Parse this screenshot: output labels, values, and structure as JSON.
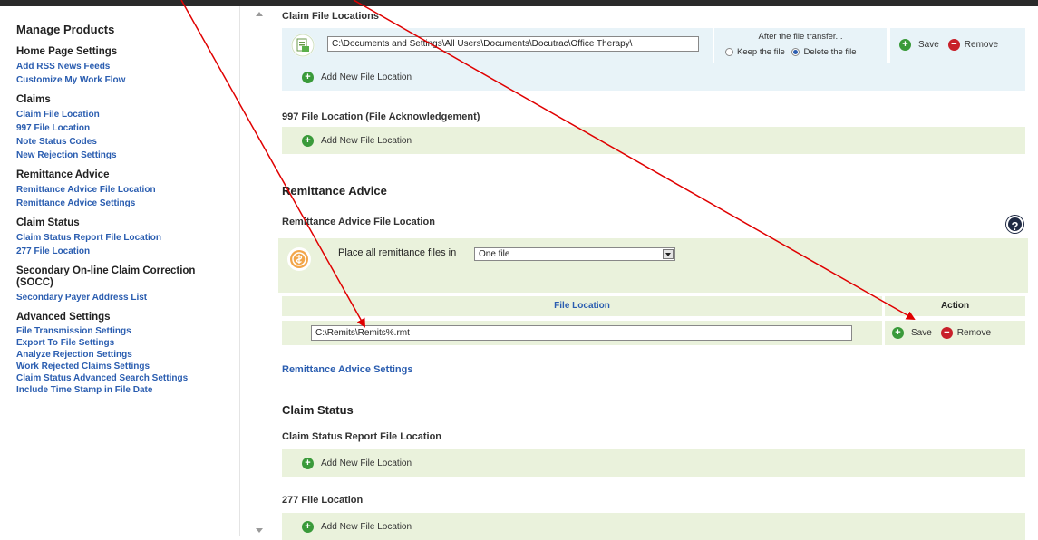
{
  "sidebar": {
    "title": "Manage Products",
    "groups": [
      {
        "heading": "Home Page Settings",
        "items": [
          "Add RSS News Feeds",
          "Customize My Work Flow"
        ]
      },
      {
        "heading": "Claims",
        "items": [
          "Claim File Location",
          "997 File Location",
          "Note Status Codes",
          "New Rejection Settings"
        ]
      },
      {
        "heading": "Remittance Advice",
        "items": [
          "Remittance Advice File Location",
          "Remittance Advice Settings"
        ]
      },
      {
        "heading": "Claim Status",
        "items": [
          "Claim Status Report File Location",
          "277 File Location"
        ]
      },
      {
        "heading": "Secondary On-line Claim Correction (SOCC)",
        "items": [
          "Secondary Payer Address List"
        ]
      },
      {
        "heading": "Advanced Settings",
        "items": [
          "File Transmission Settings",
          "Export To File Settings",
          "Analyze Rejection Settings",
          "Work Rejected Claims Settings",
          "Claim Status Advanced Search Settings",
          "Include Time Stamp in File Date"
        ]
      }
    ]
  },
  "claims": {
    "claim_file_locations_title": "Claim File Locations",
    "claim_path": "C:\\Documents and Settings\\All Users\\Documents\\Docutrac\\Office Therapy\\",
    "after_transfer_label": "After the file transfer...",
    "keep_label": "Keep the file",
    "delete_label": "Delete the file",
    "save_label": "Save",
    "remove_label": "Remove",
    "add_new_label": "Add New File Location",
    "ack_title": "997 File Location (File Acknowledgement)"
  },
  "remittance": {
    "section_title": "Remittance Advice",
    "file_location_title": "Remittance Advice File Location",
    "place_label": "Place all remittance files in",
    "place_value": "One file",
    "col_file_location": "File Location",
    "col_action": "Action",
    "path_value": "C:\\Remits\\Remits%.rmt",
    "save_label": "Save",
    "remove_label": "Remove",
    "settings_link": "Remittance Advice Settings",
    "help_symbol": "?"
  },
  "claim_status": {
    "section_title": "Claim Status",
    "report_title": "Claim Status Report File Location",
    "add_new_label": "Add New File Location",
    "loc277_title": "277 File Location"
  },
  "colors": {
    "link_blue": "#2a5db0",
    "panel_green": "#eaf2dc",
    "panel_blue": "#e8f3f8",
    "add_green": "#3a9a3a",
    "remove_red": "#c8202a",
    "arrow_red": "#e00000"
  }
}
